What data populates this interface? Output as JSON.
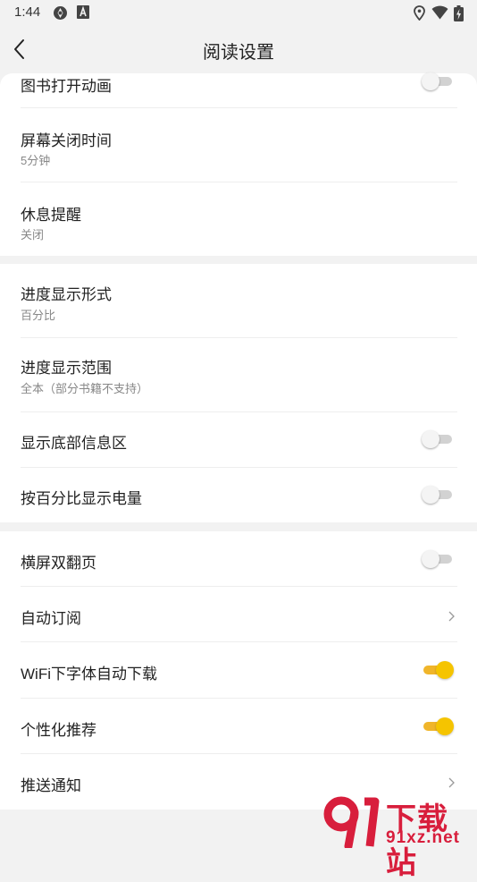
{
  "status_bar": {
    "time": "1:44",
    "icons_left": [
      "sync-icon",
      "a-icon"
    ],
    "icons_right": [
      "location-icon",
      "wifi-icon",
      "battery-icon"
    ]
  },
  "header": {
    "title": "阅读设置",
    "back_icon": "back-arrow-icon"
  },
  "sections": [
    {
      "items": [
        {
          "label": "图书打开动画",
          "type": "toggle",
          "on": false
        },
        {
          "label": "屏幕关闭时间",
          "sub": "5分钟",
          "type": "value"
        },
        {
          "label": "休息提醒",
          "sub": "关闭",
          "type": "value"
        }
      ]
    },
    {
      "items": [
        {
          "label": "进度显示形式",
          "sub": "百分比",
          "type": "value"
        },
        {
          "label": "进度显示范围",
          "sub": "全本（部分书籍不支持）",
          "type": "value"
        },
        {
          "label": "显示底部信息区",
          "type": "toggle",
          "on": false
        },
        {
          "label": "按百分比显示电量",
          "type": "toggle",
          "on": false
        }
      ]
    },
    {
      "items": [
        {
          "label": "横屏双翻页",
          "type": "toggle",
          "on": false
        },
        {
          "label": "自动订阅",
          "type": "link"
        },
        {
          "label": "WiFi下字体自动下载",
          "type": "toggle",
          "on": true
        },
        {
          "label": "个性化推荐",
          "type": "toggle",
          "on": true
        },
        {
          "label": "推送通知",
          "type": "link"
        }
      ]
    }
  ],
  "watermark": {
    "logo": "91-logo",
    "line1": "下载站",
    "line2": "91xz.net"
  },
  "colors": {
    "background": "#f2f2f2",
    "card": "#ffffff",
    "toggle_on": "#f5c400",
    "toggle_off": "#d2d2d2",
    "watermark": "#d81e3c"
  }
}
